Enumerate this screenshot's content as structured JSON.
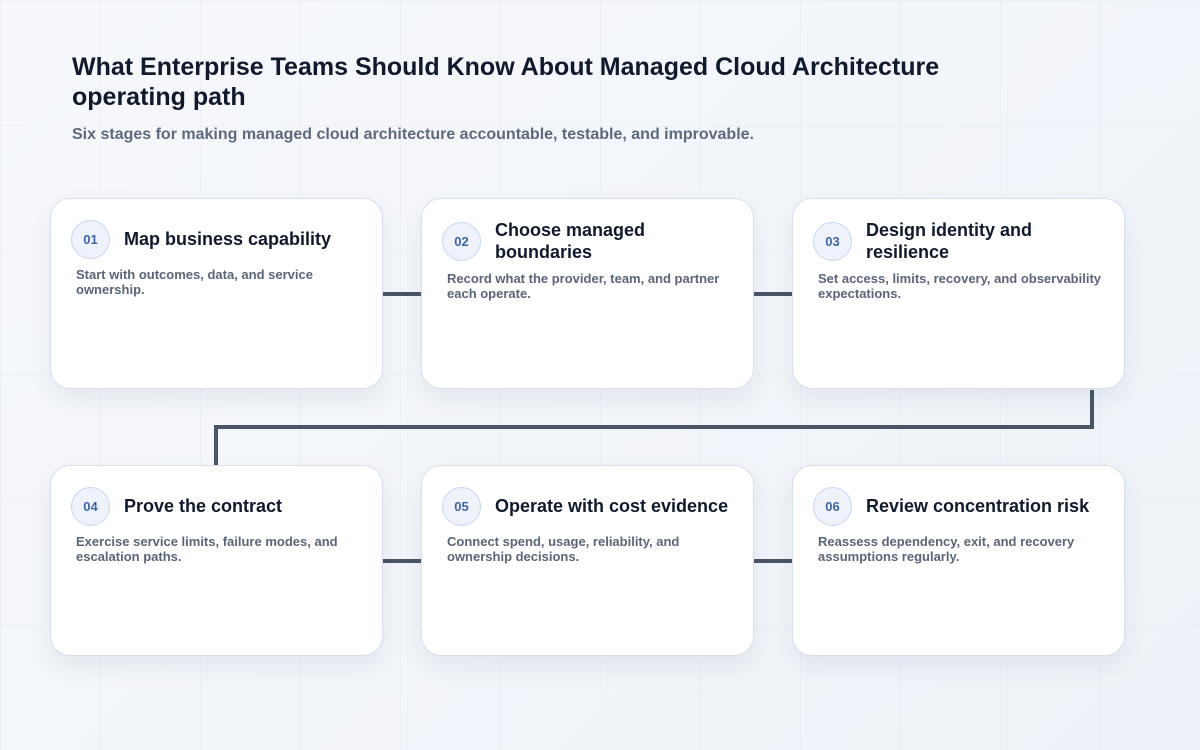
{
  "page": {
    "title": "What Enterprise Teams Should Know About Managed Cloud Architecture operating path",
    "subtitle": "Six stages for making managed cloud architecture accountable, testable, and improvable."
  },
  "stages": [
    {
      "number": "01",
      "title": "Map business capability",
      "description": "Start with outcomes, data, and service ownership."
    },
    {
      "number": "02",
      "title": "Choose managed boundaries",
      "description": "Record what the provider, team, and partner each operate."
    },
    {
      "number": "03",
      "title": "Design identity and resilience",
      "description": "Set access, limits, recovery, and observability expectations."
    },
    {
      "number": "04",
      "title": "Prove the contract",
      "description": "Exercise service limits, failure modes, and escalation paths."
    },
    {
      "number": "05",
      "title": "Operate with cost evidence",
      "description": "Connect spend, usage, reliability, and ownership decisions."
    },
    {
      "number": "06",
      "title": "Review concentration risk",
      "description": "Reassess dependency, exit, and recovery assumptions regularly."
    }
  ],
  "colors": {
    "connector": "#4a5566",
    "badge_text": "#3d64a8",
    "heading": "#101a2c"
  }
}
